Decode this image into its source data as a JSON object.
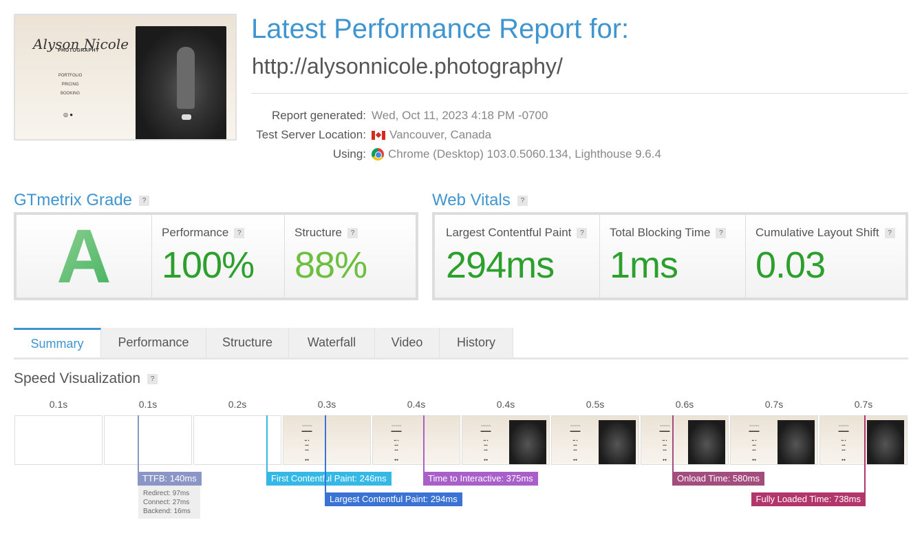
{
  "thumbnail": {
    "logo_script": "Alyson Nicole",
    "logo_sub": "PHOTOGRAPHY",
    "nav": [
      "PORTFOLIO",
      "PRICING",
      "BOOKING"
    ]
  },
  "header": {
    "title": "Latest Performance Report for:",
    "url": "http://alysonnicole.photography/"
  },
  "info": [
    {
      "label": "Report generated:",
      "value": "Wed, Oct 11, 2023 4:18 PM -0700"
    },
    {
      "label": "Test Server Location:",
      "value": "Vancouver, Canada",
      "icon": "canada-flag-icon"
    },
    {
      "label": "Using:",
      "value": "Chrome (Desktop) 103.0.5060.134, Lighthouse 9.6.4",
      "icon": "chrome-icon"
    }
  ],
  "grade": {
    "heading": "GTmetrix Grade",
    "help": "?",
    "letter": "A",
    "performance_label": "Performance",
    "performance": "100%",
    "structure_label": "Structure",
    "structure": "88%",
    "colors": {
      "performance": "#2ca02c",
      "structure": "#6cbf3f"
    }
  },
  "vitals": {
    "heading": "Web Vitals",
    "help": "?",
    "items": [
      {
        "label": "Largest Contentful Paint",
        "value": "294ms"
      },
      {
        "label": "Total Blocking Time",
        "value": "1ms"
      },
      {
        "label": "Cumulative Layout Shift",
        "value": "0.03"
      }
    ]
  },
  "tabs": [
    "Summary",
    "Performance",
    "Structure",
    "Waterfall",
    "Video",
    "History"
  ],
  "active_tab": "Summary",
  "speed": {
    "heading": "Speed Visualization",
    "help": "?",
    "frame_times": [
      "0.1s",
      "0.1s",
      "0.2s",
      "0.3s",
      "0.4s",
      "0.4s",
      "0.5s",
      "0.6s",
      "0.7s",
      "0.7s"
    ],
    "frame_states": [
      "blank",
      "blank",
      "blank",
      "partial",
      "partial",
      "full",
      "full",
      "full",
      "full",
      "full"
    ],
    "markers": [
      {
        "label": "TTFB: 140ms",
        "ms": 140,
        "color": "#8b96c6",
        "row": 0
      },
      {
        "label": "First Contentful Paint: 246ms",
        "ms": 246,
        "color": "#34b9e6",
        "row": 0
      },
      {
        "label": "Largest Contentful Paint: 294ms",
        "ms": 294,
        "color": "#3b73d4",
        "row": 1
      },
      {
        "label": "Time to Interactive: 375ms",
        "ms": 375,
        "color": "#a85fca",
        "row": 0
      },
      {
        "label": "Onload Time: 580ms",
        "ms": 580,
        "color": "#a24d7e",
        "row": 0
      },
      {
        "label": "Fully Loaded Time: 738ms",
        "ms": 738,
        "color": "#b2366b",
        "row": 1,
        "align": "right"
      }
    ],
    "ttfb_breakdown": [
      "Redirect: 97ms",
      "Connect: 27ms",
      "Backend: 16ms"
    ]
  }
}
